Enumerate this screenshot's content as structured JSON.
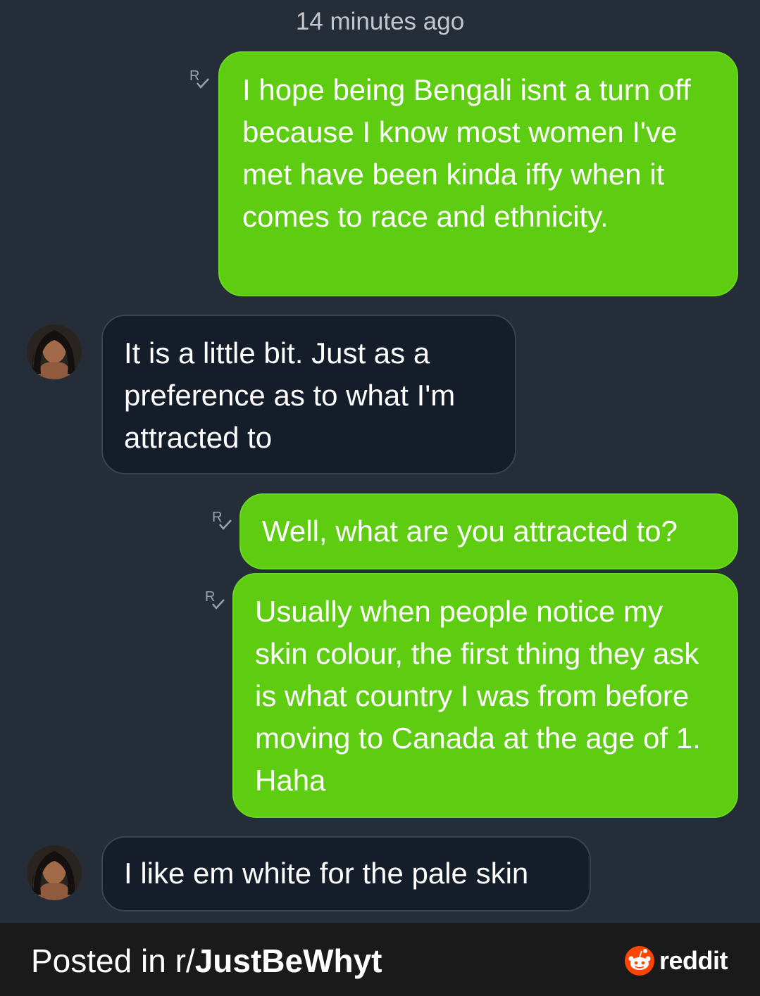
{
  "conversation": {
    "timestamp": "14 minutes ago",
    "messages": [
      {
        "direction": "outgoing",
        "text": "I hope being Bengali isnt a turn off because I know most women I've met have been kinda iffy when it comes to race and ethnicity.",
        "receipt_icon": "read-receipt-icon"
      },
      {
        "direction": "incoming",
        "text": "It is a little bit. Just as a preference as to what I'm attracted to",
        "avatar_icon": "contact-avatar"
      },
      {
        "direction": "outgoing",
        "text": "Well, what are you attracted to?",
        "receipt_icon": "read-receipt-icon"
      },
      {
        "direction": "outgoing",
        "text": "Usually when people notice my skin colour, the first thing they ask is what country I was from before moving to Canada at the age of 1. Haha",
        "receipt_icon": "read-receipt-icon"
      },
      {
        "direction": "incoming",
        "text": "I like em white for the pale skin",
        "avatar_icon": "contact-avatar"
      }
    ]
  },
  "footer": {
    "prefix": "Posted in r/",
    "subreddit": "JustBeWhyt",
    "brand": "reddit",
    "brand_icon": "reddit-snoo-icon"
  },
  "colors": {
    "background": "#252d39",
    "outgoing_bubble": "#5ecd12",
    "incoming_bubble": "#141d29",
    "footer_bar": "#1a1a1a",
    "reddit_orange": "#ff4500"
  }
}
